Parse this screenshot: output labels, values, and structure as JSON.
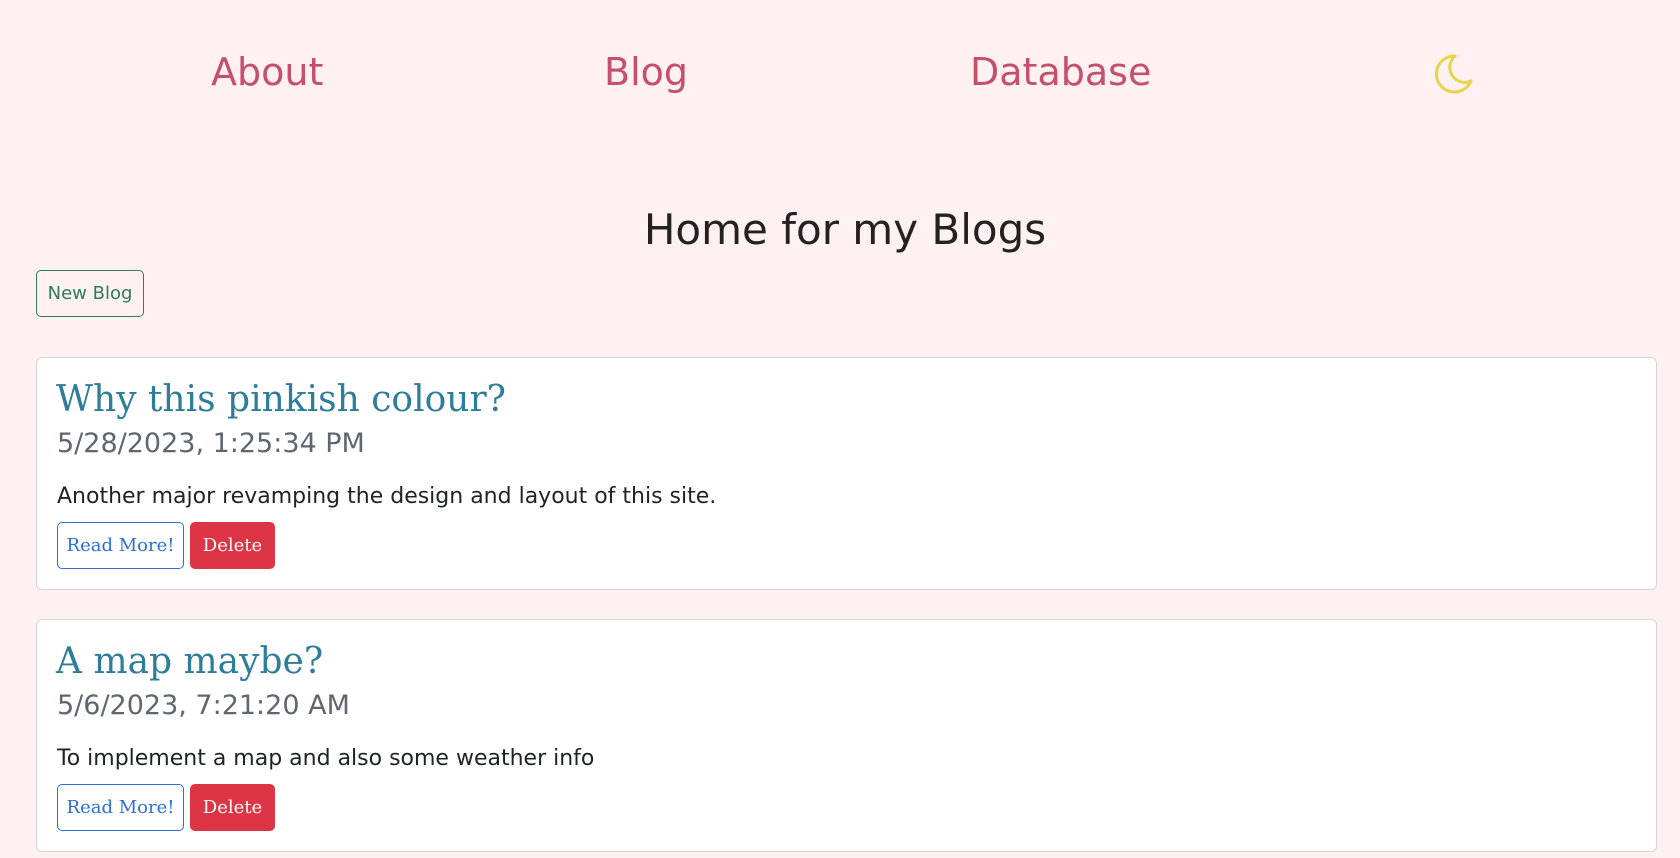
{
  "nav": {
    "about": "About",
    "blog": "Blog",
    "database": "Database",
    "theme_icon": "moon-icon",
    "theme_icon_color": "#e6d44b",
    "link_color": "#c4506e"
  },
  "page": {
    "title": "Home for my Blogs",
    "new_blog_label": "New Blog",
    "background": "#fff0f1"
  },
  "posts": [
    {
      "title": "Why this pinkish colour?",
      "date": "5/28/2023, 1:25:34 PM",
      "summary": "Another major revamping the design and layout of this site.",
      "read_more_label": "Read More!",
      "delete_label": "Delete"
    },
    {
      "title": "A map maybe?",
      "date": "5/6/2023, 7:21:20 AM",
      "summary": "To implement a map and also some weather info",
      "read_more_label": "Read More!",
      "delete_label": "Delete"
    }
  ],
  "colors": {
    "card_title": "#2e7d9a",
    "read_more": "#2c6fd6",
    "delete": "#dc3545",
    "new_blog": "#2f7d56"
  }
}
